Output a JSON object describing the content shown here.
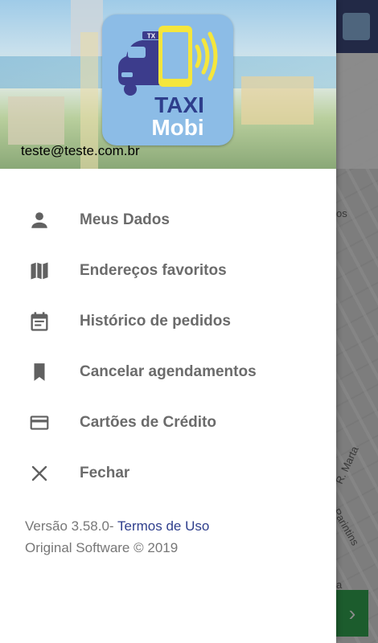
{
  "user": {
    "email": "teste@teste.com.br"
  },
  "logo": {
    "brand_line1": "TAXI",
    "brand_line2": "Mobi",
    "roof_sign": "TX"
  },
  "menu": {
    "items": [
      {
        "label": "Meus Dados",
        "icon": "person-icon"
      },
      {
        "label": "Endereços favoritos",
        "icon": "map-icon"
      },
      {
        "label": "Histórico de pedidos",
        "icon": "calendar-icon"
      },
      {
        "label": "Cancelar agendamentos",
        "icon": "bookmark-icon"
      },
      {
        "label": "Cartões de Crédito",
        "icon": "credit-card-icon"
      },
      {
        "label": "Fechar",
        "icon": "close-icon"
      }
    ]
  },
  "footer": {
    "version": "Versão 3.58.0-",
    "terms_link": "Termos de Uso",
    "copyright": "Original Software © 2019"
  },
  "background": {
    "street_labels": [
      "os",
      "R. Marta",
      "Parintins",
      "a"
    ]
  },
  "colors": {
    "icon": "#616161",
    "label": "#6b6b6b",
    "link": "#2e3e8c",
    "logo_bg": "#8cbce6",
    "car": "#3c3c8c",
    "phone": "#f5e63c",
    "action_green": "#34a853"
  }
}
